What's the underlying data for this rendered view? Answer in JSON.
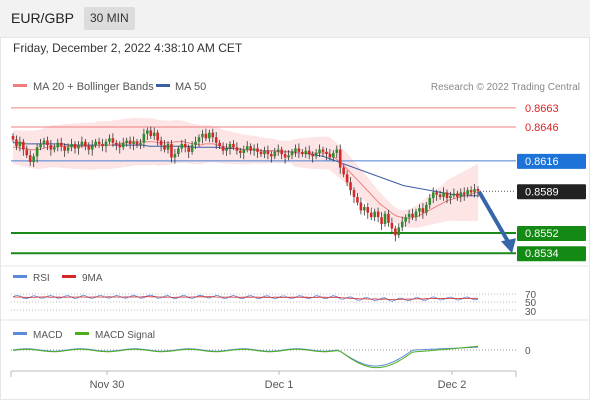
{
  "header": {
    "pair": "EUR/GBP",
    "timeframe": "30 MIN"
  },
  "datetime": "Friday, December 2, 2022 4:38:10 AM CET",
  "legend": {
    "bollinger": "MA 20 + Bollinger Bands",
    "ma50": "MA 50",
    "source": "Research © 2022 Trading Central"
  },
  "colors": {
    "up_candle": "#2e8b2e",
    "down_candle": "#d62728",
    "ma20": "#f08080",
    "bb_fill": "#fde0e0",
    "ma50": "#3a5fa8",
    "support": "#1a8a1a",
    "resistance": "#f08080",
    "pivot": "#4a7fd4",
    "rsi": "#5b8ad8",
    "rsi_ma": "#d62728",
    "macd": "#5b8ad8",
    "macd_signal": "#4caf1a",
    "arrow": "#3567a8"
  },
  "price_levels": [
    {
      "value": "0.8663",
      "kind": "resistance"
    },
    {
      "value": "0.8646",
      "kind": "resistance"
    },
    {
      "value": "0.8616",
      "kind": "pivot"
    },
    {
      "value": "0.8589",
      "kind": "last"
    },
    {
      "value": "0.8552",
      "kind": "support"
    },
    {
      "value": "0.8534",
      "kind": "support"
    }
  ],
  "rsi_panel": {
    "label": "RSI",
    "ma_label": "9MA",
    "levels": [
      "70",
      "50",
      "30"
    ]
  },
  "macd_panel": {
    "label": "MACD",
    "signal_label": "MACD Signal",
    "zero": "0"
  },
  "x_axis": {
    "labels": [
      "Nov 30",
      "Dec 1",
      "Dec 2"
    ]
  },
  "chart_data": {
    "type": "candlestick",
    "instrument": "EUR/GBP",
    "interval": "30 MIN",
    "ylim": [
      0.8528,
      0.867
    ],
    "close_series": [
      0.8635,
      0.8629,
      0.8633,
      0.8626,
      0.8621,
      0.8615,
      0.862,
      0.8628,
      0.8631,
      0.8634,
      0.863,
      0.8626,
      0.8628,
      0.8632,
      0.8629,
      0.8625,
      0.8628,
      0.8631,
      0.8627,
      0.863,
      0.8633,
      0.8629,
      0.8626,
      0.863,
      0.8633,
      0.8631,
      0.8629,
      0.8633,
      0.8636,
      0.8632,
      0.863,
      0.8628,
      0.8632,
      0.8634,
      0.8631,
      0.8633,
      0.863,
      0.8632,
      0.864,
      0.8643,
      0.8638,
      0.8641,
      0.8634,
      0.863,
      0.8626,
      0.8631,
      0.8619,
      0.8622,
      0.8627,
      0.8631,
      0.8628,
      0.8624,
      0.863,
      0.8633,
      0.8637,
      0.864,
      0.8636,
      0.8641,
      0.8637,
      0.8632,
      0.8629,
      0.8625,
      0.8627,
      0.8631,
      0.8628,
      0.8625,
      0.8623,
      0.8626,
      0.8629,
      0.8625,
      0.8627,
      0.8624,
      0.8622,
      0.8625,
      0.8622,
      0.862,
      0.8624,
      0.8626,
      0.8622,
      0.8619,
      0.8621,
      0.8624,
      0.8627,
      0.8624,
      0.8622,
      0.8625,
      0.8622,
      0.862,
      0.8623,
      0.8626,
      0.8624,
      0.8622,
      0.8619,
      0.8623,
      0.8626,
      0.861,
      0.8604,
      0.8597,
      0.859,
      0.8584,
      0.8579,
      0.8572,
      0.8575,
      0.857,
      0.8566,
      0.8571,
      0.8566,
      0.856,
      0.8569,
      0.8561,
      0.8556,
      0.855,
      0.8557,
      0.8562,
      0.8566,
      0.8569,
      0.8566,
      0.8571,
      0.8574,
      0.857,
      0.8577,
      0.8583,
      0.8588,
      0.8586,
      0.8584,
      0.8588,
      0.8583,
      0.8585,
      0.8587,
      0.8584,
      0.8588,
      0.8586,
      0.859,
      0.8588,
      0.8591,
      0.8589
    ],
    "ma20": [
      0.8628,
      0.8628,
      0.8627,
      0.8627,
      0.8626,
      0.8626,
      0.8626,
      0.8627,
      0.8628,
      0.8629,
      0.8629,
      0.8629,
      0.8629,
      0.8629,
      0.8629,
      0.8629,
      0.8629,
      0.8629,
      0.8629,
      0.8629,
      0.863,
      0.863,
      0.863,
      0.863,
      0.8631,
      0.8631,
      0.8632,
      0.8632,
      0.8633,
      0.8633,
      0.8633,
      0.8633,
      0.8633,
      0.8633,
      0.8632,
      0.8632,
      0.8632,
      0.8632,
      0.8633,
      0.8633,
      0.8633,
      0.8632,
      0.8631,
      0.8631,
      0.863,
      0.8631,
      0.8631,
      0.8631,
      0.863,
      0.8629,
      0.8628,
      0.8628,
      0.8627,
      0.8627,
      0.8626,
      0.8626,
      0.8626,
      0.8626,
      0.8625,
      0.8625,
      0.8625,
      0.8625,
      0.8624,
      0.8624,
      0.8624,
      0.8624,
      0.8623,
      0.8623,
      0.8623,
      0.8623,
      0.8623,
      0.8623,
      0.8623,
      0.8623,
      0.8623,
      0.862,
      0.8617,
      0.8614,
      0.861,
      0.8606,
      0.8602,
      0.8598,
      0.8594,
      0.859,
      0.8586,
      0.8582,
      0.8578,
      0.8575,
      0.8572,
      0.8569,
      0.8567,
      0.8566,
      0.8565,
      0.8565,
      0.8566,
      0.8567,
      0.8569,
      0.8571,
      0.8573,
      0.8575,
      0.8577,
      0.8579,
      0.8581,
      0.8582,
      0.8583,
      0.8584,
      0.8585,
      0.8586,
      0.8587,
      0.8588
    ],
    "ma50": [
      0.8632,
      0.8632,
      0.8631,
      0.8631,
      0.8631,
      0.8631,
      0.8631,
      0.8631,
      0.8631,
      0.863,
      0.863,
      0.863,
      0.863,
      0.863,
      0.863,
      0.863,
      0.863,
      0.863,
      0.863,
      0.863,
      0.863,
      0.863,
      0.8629,
      0.8629,
      0.8629,
      0.8629,
      0.8629,
      0.8629,
      0.8629,
      0.8628,
      0.8628,
      0.8628,
      0.8628,
      0.8628,
      0.8627,
      0.8627,
      0.8627,
      0.8626,
      0.8626,
      0.8626,
      0.8625,
      0.8625,
      0.8625,
      0.8624,
      0.8624,
      0.8624,
      0.8623,
      0.8623,
      0.8622,
      0.8621,
      0.862,
      0.8618,
      0.8616,
      0.8614,
      0.8612,
      0.861,
      0.8608,
      0.8606,
      0.8604,
      0.8602,
      0.86,
      0.8598,
      0.8596,
      0.8594,
      0.8593,
      0.8592,
      0.8591,
      0.859,
      0.8589,
      0.8588,
      0.8587,
      0.8586,
      0.8586,
      0.8585,
      0.8585,
      0.8585
    ],
    "levels": [
      0.8663,
      0.8646,
      0.8616,
      0.8552,
      0.8534
    ],
    "last_price": 0.8589,
    "forecast_arrow": {
      "from": 0.8589,
      "to": 0.8534
    },
    "x_tick_labels": [
      "Nov 30",
      "Dec 1",
      "Dec 2"
    ],
    "rsi_levels": [
      70,
      50,
      30
    ],
    "macd_zero": 0
  }
}
